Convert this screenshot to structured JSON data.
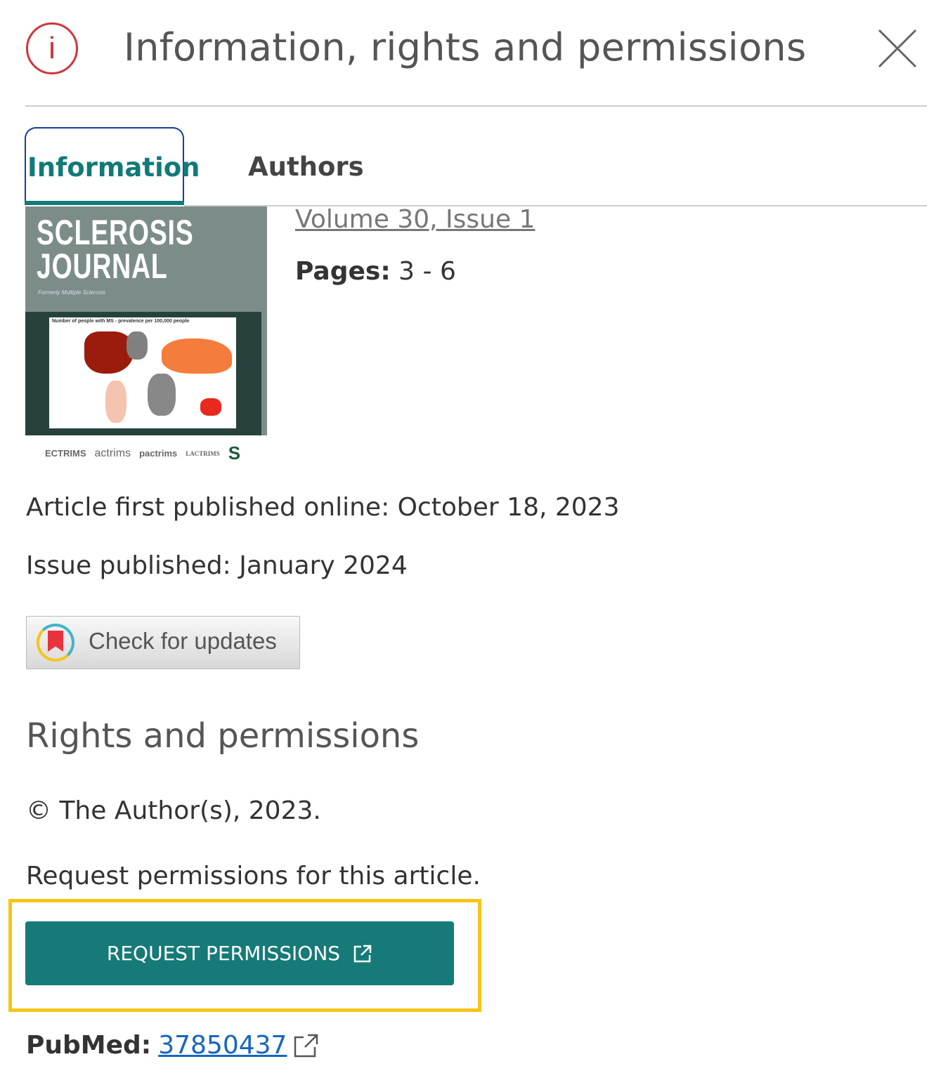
{
  "header": {
    "title": "Information, rights and permissions",
    "info_icon": "info-circle-icon",
    "close_icon": "close-x-icon"
  },
  "tabs": [
    {
      "label": "Information",
      "active": true
    },
    {
      "label": "Authors",
      "active": false
    }
  ],
  "cover": {
    "title_line1": "SCLEROSIS",
    "title_line2": "JOURNAL",
    "subtitle": "Formerly Multiple Sclerosis",
    "map_title": "Number of people with MS - prevalence per 100,000 people",
    "logos": [
      "ECTRIMS",
      "actrims",
      "pactrims",
      "LACTRIMS",
      "S"
    ]
  },
  "issue": {
    "volume_link": "Volume 30, Issue 1",
    "pages_label": "Pages:",
    "pages_value": " 3 - 6"
  },
  "published_online": "Article first published online: October 18, 2023",
  "issue_published": "Issue published: January 2024",
  "check_updates": "Check for updates",
  "rights": {
    "heading": "Rights and permissions",
    "copyright": "© The Author(s), 2023.",
    "request_text": "Request permissions for this article.",
    "button": "REQUEST PERMISSIONS"
  },
  "pubmed": {
    "label": "PubMed:",
    "id": "37850437"
  },
  "colors": {
    "accent": "#167a78",
    "highlight": "#f5c518",
    "info_icon": "#d0363b",
    "link": "#1565c0"
  }
}
